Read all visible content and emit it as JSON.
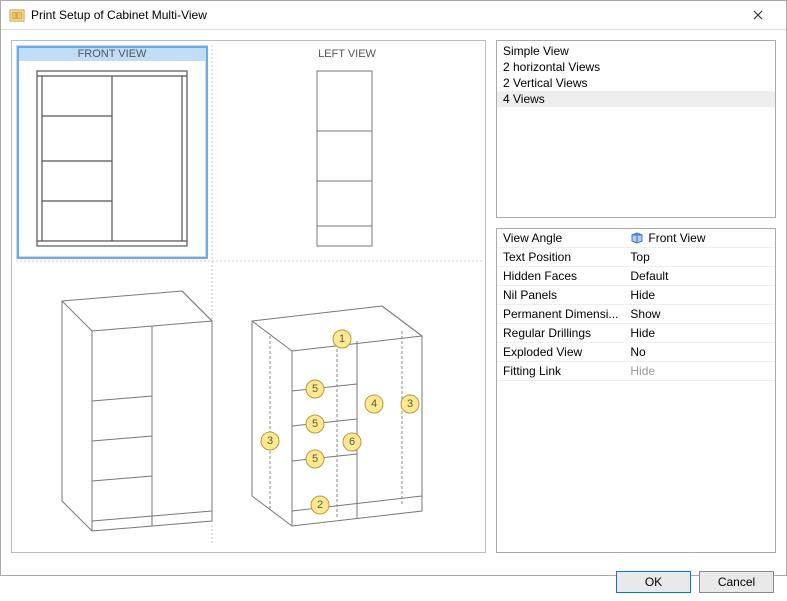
{
  "title": "Print Setup of Cabinet Multi-View",
  "preview": {
    "front_label": "FRONT VIEW",
    "left_label": "LEFT VIEW",
    "callouts": {
      "c1": "1",
      "c2": "2",
      "c3a": "3",
      "c3b": "3",
      "c4": "4",
      "c5a": "5",
      "c5b": "5",
      "c5c": "5",
      "c6": "6"
    }
  },
  "view_list": {
    "items": [
      {
        "label": "Simple View",
        "selected": false
      },
      {
        "label": "2 horizontal Views",
        "selected": false
      },
      {
        "label": "2 Vertical Views",
        "selected": false
      },
      {
        "label": "4 Views",
        "selected": true
      }
    ]
  },
  "props": {
    "rows": [
      {
        "label": "View Angle",
        "value": "Front View",
        "icon": true
      },
      {
        "label": "Text Position",
        "value": "Top"
      },
      {
        "label": "Hidden Faces",
        "value": "Default"
      },
      {
        "label": "Nil Panels",
        "value": "Hide"
      },
      {
        "label": "Permanent Dimensi...",
        "value": "Show"
      },
      {
        "label": "Regular Drillings",
        "value": "Hide"
      },
      {
        "label": "Exploded View",
        "value": "No"
      },
      {
        "label": "Fitting Link",
        "value": "Hide",
        "disabled": true
      }
    ]
  },
  "buttons": {
    "ok": "OK",
    "cancel": "Cancel"
  }
}
